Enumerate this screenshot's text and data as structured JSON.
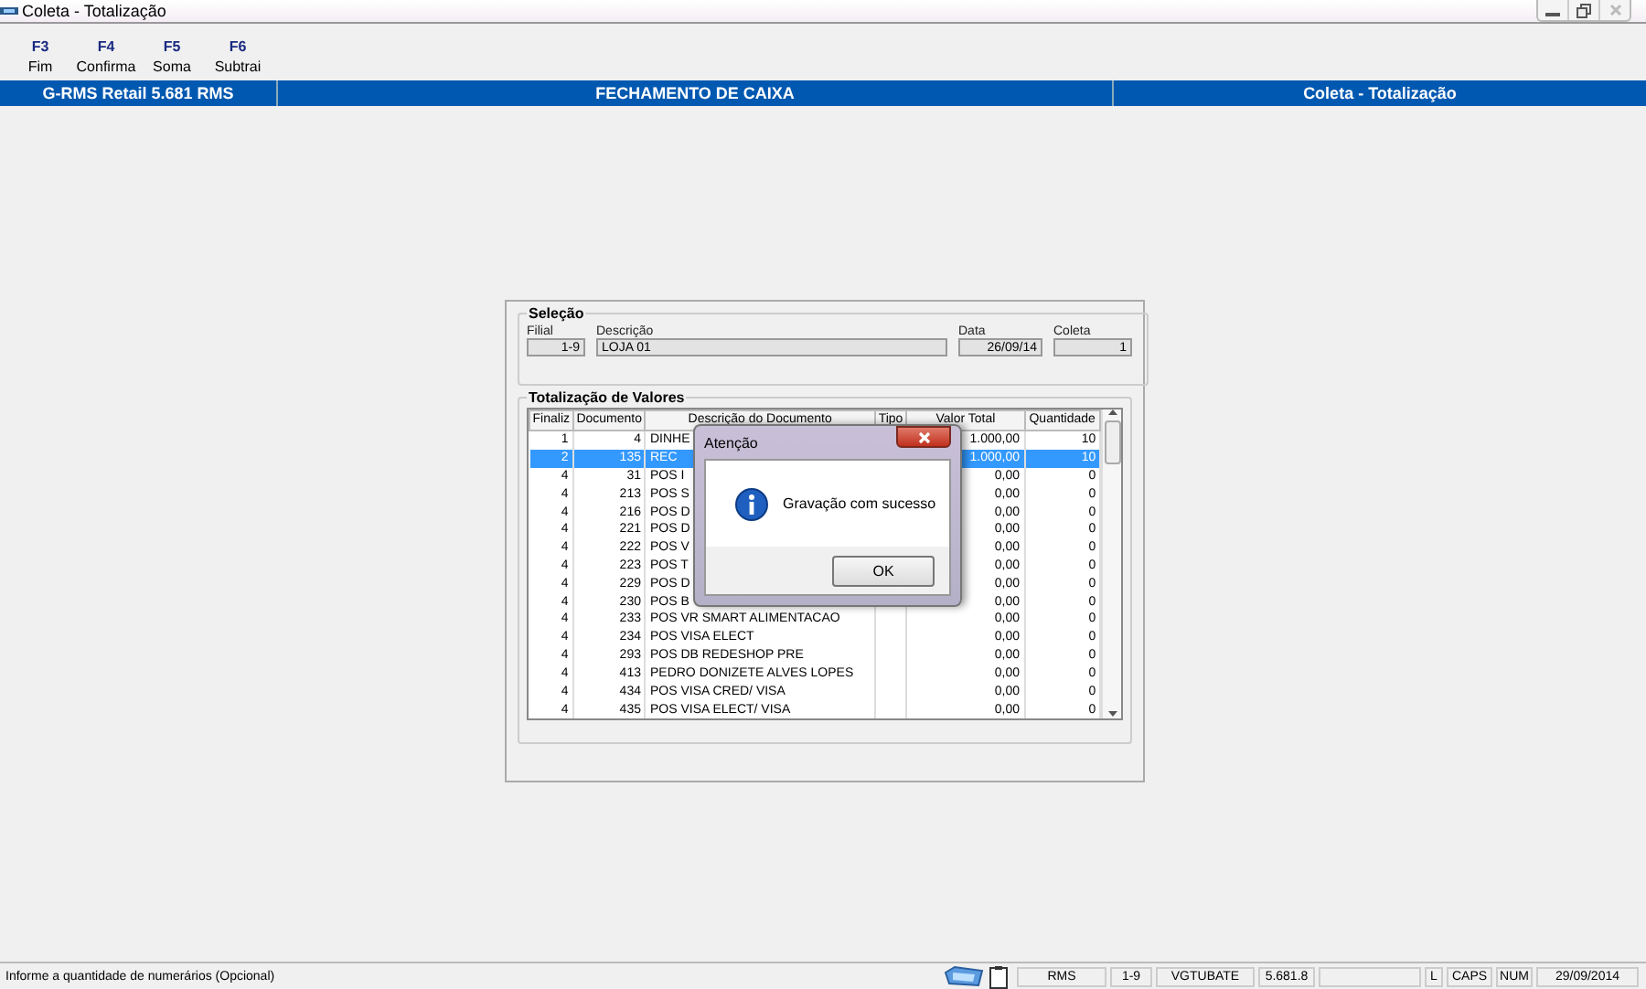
{
  "window": {
    "title": "Coleta - Totalização"
  },
  "toolbar": [
    {
      "key": "F3",
      "label": "Fim"
    },
    {
      "key": "F4",
      "label": "Confirma"
    },
    {
      "key": "F5",
      "label": "Soma"
    },
    {
      "key": "F6",
      "label": "Subtrai"
    }
  ],
  "header_bar": {
    "left": "G-RMS Retail 5.681 RMS",
    "center": "FECHAMENTO DE CAIXA",
    "right": "Coleta - Totalização"
  },
  "selection": {
    "title": "Seleção",
    "filial_label": "Filial",
    "filial": "1-9",
    "descricao_label": "Descrição",
    "descricao": "LOJA 01",
    "data_label": "Data",
    "data": "26/09/14",
    "coleta_label": "Coleta",
    "coleta": "1"
  },
  "totals": {
    "title": "Totalização de Valores",
    "columns": [
      "Finaliz",
      "Documento",
      "Descrição do Documento",
      "Tipo",
      "Valor Total",
      "Quantidade"
    ],
    "rows": [
      {
        "finaliz": "1",
        "documento": "4",
        "descricao": "DINHE",
        "valor": "1.000,00",
        "quantidade": "10",
        "selected": false
      },
      {
        "finaliz": "2",
        "documento": "135",
        "descricao": "REC",
        "valor": "1.000,00",
        "quantidade": "10",
        "selected": true
      },
      {
        "finaliz": "4",
        "documento": "31",
        "descricao": "POS I",
        "valor": "0,00",
        "quantidade": "0",
        "selected": false
      },
      {
        "finaliz": "4",
        "documento": "213",
        "descricao": "POS S",
        "valor": "0,00",
        "quantidade": "0",
        "selected": false
      },
      {
        "finaliz": "4",
        "documento": "216",
        "descricao": "POS D",
        "valor": "0,00",
        "quantidade": "0",
        "selected": false
      },
      {
        "finaliz": "4",
        "documento": "221",
        "descricao": "POS D",
        "valor": "0,00",
        "quantidade": "0",
        "selected": false
      },
      {
        "finaliz": "4",
        "documento": "222",
        "descricao": "POS V",
        "valor": "0,00",
        "quantidade": "0",
        "selected": false
      },
      {
        "finaliz": "4",
        "documento": "223",
        "descricao": "POS T",
        "valor": "0,00",
        "quantidade": "0",
        "selected": false
      },
      {
        "finaliz": "4",
        "documento": "229",
        "descricao": "POS D",
        "valor": "0,00",
        "quantidade": "0",
        "selected": false
      },
      {
        "finaliz": "4",
        "documento": "230",
        "descricao": "POS B",
        "valor": "0,00",
        "quantidade": "0",
        "selected": false
      },
      {
        "finaliz": "4",
        "documento": "233",
        "descricao": "POS VR SMART ALIMENTACAO",
        "valor": "0,00",
        "quantidade": "0",
        "selected": false
      },
      {
        "finaliz": "4",
        "documento": "234",
        "descricao": "POS VISA ELECT",
        "valor": "0,00",
        "quantidade": "0",
        "selected": false
      },
      {
        "finaliz": "4",
        "documento": "293",
        "descricao": "POS DB REDESHOP PRE",
        "valor": "0,00",
        "quantidade": "0",
        "selected": false
      },
      {
        "finaliz": "4",
        "documento": "413",
        "descricao": "PEDRO DONIZETE ALVES LOPES",
        "valor": "0,00",
        "quantidade": "0",
        "selected": false
      },
      {
        "finaliz": "4",
        "documento": "434",
        "descricao": "POS VISA CRED/ VISA",
        "valor": "0,00",
        "quantidade": "0",
        "selected": false
      },
      {
        "finaliz": "4",
        "documento": "435",
        "descricao": "POS VISA ELECT/ VISA",
        "valor": "0,00",
        "quantidade": "0",
        "selected": false
      }
    ]
  },
  "dialog": {
    "title": "Atenção",
    "message": "Gravação com sucesso",
    "button": "OK"
  },
  "status_bar": {
    "message": "Informe a quantidade de numerários (Opcional)",
    "cells": [
      "RMS",
      "1-9",
      "VGTUBATE",
      "5.681.8",
      "",
      "L",
      "CAPS",
      "NUM",
      "29/09/2014"
    ]
  }
}
